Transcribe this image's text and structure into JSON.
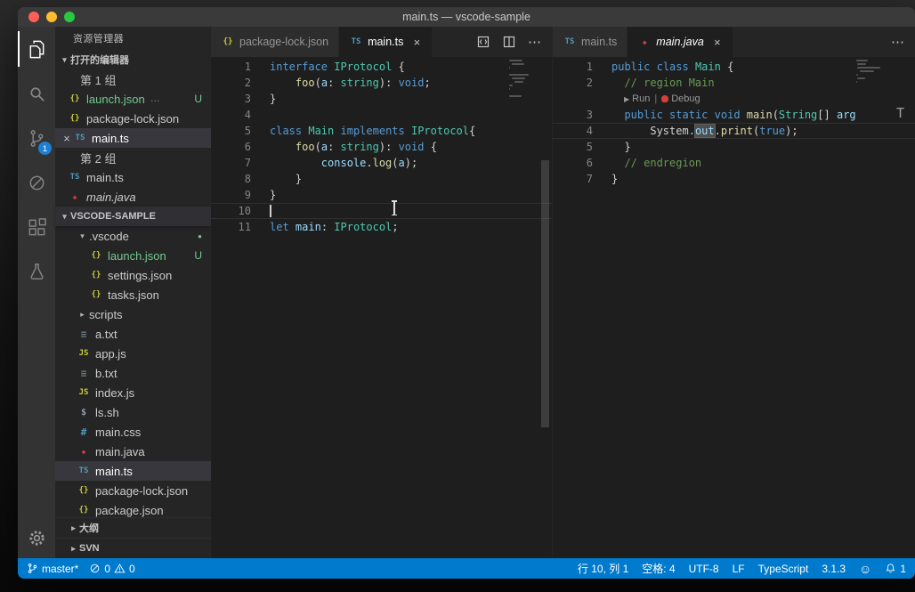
{
  "window": {
    "title": "main.ts — vscode-sample"
  },
  "icons": {
    "chevron-down": "▾",
    "chevron-right": "▸",
    "close": "×",
    "more-actions": "⋯",
    "run-play": "▶",
    "feedback-smiley": "☺",
    "modified-dot": "●"
  },
  "icon_glyphs": {
    "json": "{}",
    "ts": "TS",
    "js": "JS",
    "txt": "≡",
    "sh": "$",
    "css": "#",
    "java": "◆"
  },
  "colors": {
    "accent": "#007acc",
    "untracked_green": "#73c991",
    "selection": "#37373d",
    "scm_badge": "#1d80d6"
  },
  "activity_bar": {
    "scm_badge": "1",
    "items": [
      "explorer",
      "search",
      "source-control",
      "debug-disabled",
      "extensions",
      "test"
    ],
    "bottom": [
      "settings-gear"
    ]
  },
  "sidebar": {
    "title": "资源管理器",
    "sections": {
      "open_editors": "打开的编辑器",
      "root": "VSCODE-SAMPLE",
      "outline": "大纲",
      "svn": "SVN"
    },
    "open_editors_rows": [
      {
        "kind": "group",
        "label": "第 1 组"
      },
      {
        "kind": "file",
        "icon": "json",
        "name": "launch.json",
        "desc": "…",
        "badge": "U",
        "git": true
      },
      {
        "kind": "file",
        "icon": "json",
        "name": "package-lock.json"
      },
      {
        "kind": "file",
        "icon": "ts",
        "name": "main.ts",
        "active": true,
        "close": true
      },
      {
        "kind": "group",
        "label": "第 2 组"
      },
      {
        "kind": "file",
        "icon": "ts",
        "name": "main.ts"
      },
      {
        "kind": "file",
        "icon": "java",
        "name": "main.java",
        "italic": true
      }
    ],
    "tree_rows": [
      {
        "kind": "folder",
        "name": ".vscode",
        "expanded": true,
        "dot": true,
        "level": 1
      },
      {
        "kind": "file",
        "icon": "json",
        "name": "launch.json",
        "badge": "U",
        "git": true,
        "level": 2
      },
      {
        "kind": "file",
        "icon": "json",
        "name": "settings.json",
        "level": 2
      },
      {
        "kind": "file",
        "icon": "json",
        "name": "tasks.json",
        "level": 2
      },
      {
        "kind": "folder",
        "name": "scripts",
        "expanded": false,
        "level": 1
      },
      {
        "kind": "file",
        "icon": "txt",
        "name": "a.txt",
        "level": 1
      },
      {
        "kind": "file",
        "icon": "js",
        "name": "app.js",
        "level": 1
      },
      {
        "kind": "file",
        "icon": "txt",
        "name": "b.txt",
        "level": 1
      },
      {
        "kind": "file",
        "icon": "js",
        "name": "index.js",
        "level": 1
      },
      {
        "kind": "file",
        "icon": "sh",
        "name": "ls.sh",
        "level": 1
      },
      {
        "kind": "file",
        "icon": "css",
        "name": "main.css",
        "level": 1
      },
      {
        "kind": "file",
        "icon": "java",
        "name": "main.java",
        "level": 1
      },
      {
        "kind": "file",
        "icon": "ts",
        "name": "main.ts",
        "selected": true,
        "level": 1
      },
      {
        "kind": "file",
        "icon": "json",
        "name": "package-lock.json",
        "level": 1
      },
      {
        "kind": "file",
        "icon": "json",
        "name": "package.json",
        "level": 1
      }
    ]
  },
  "editors": {
    "left": {
      "tabs": [
        {
          "icon": "json",
          "label": "package-lock.json"
        },
        {
          "icon": "ts",
          "label": "main.ts",
          "active": true,
          "close": true
        }
      ],
      "toolbar": [
        "open-changes-icon",
        "split-editor-icon",
        "more-actions-icon"
      ],
      "lines": [
        {
          "num": 1,
          "tokens": [
            {
              "t": "interface",
              "c": "kw"
            },
            {
              "t": " ",
              "c": "pl"
            },
            {
              "t": "IProtocol",
              "c": "ty"
            },
            {
              "t": " {",
              "c": "pl"
            }
          ]
        },
        {
          "num": 2,
          "tokens": [
            {
              "t": "    ",
              "c": "pl"
            },
            {
              "t": "foo",
              "c": "fn"
            },
            {
              "t": "(",
              "c": "pl"
            },
            {
              "t": "a",
              "c": "va"
            },
            {
              "t": ": ",
              "c": "pl"
            },
            {
              "t": "string",
              "c": "ty"
            },
            {
              "t": "): ",
              "c": "pl"
            },
            {
              "t": "void",
              "c": "kw"
            },
            {
              "t": ";",
              "c": "pl"
            }
          ]
        },
        {
          "num": 3,
          "tokens": [
            {
              "t": "}",
              "c": "pl"
            }
          ]
        },
        {
          "num": 4,
          "tokens": []
        },
        {
          "num": 5,
          "tokens": [
            {
              "t": "class",
              "c": "kw"
            },
            {
              "t": " ",
              "c": "pl"
            },
            {
              "t": "Main",
              "c": "ty"
            },
            {
              "t": " ",
              "c": "pl"
            },
            {
              "t": "implements",
              "c": "kw"
            },
            {
              "t": " ",
              "c": "pl"
            },
            {
              "t": "IProtocol",
              "c": "ty"
            },
            {
              "t": "{",
              "c": "pl"
            }
          ]
        },
        {
          "num": 6,
          "tokens": [
            {
              "t": "    ",
              "c": "pl"
            },
            {
              "t": "foo",
              "c": "fn"
            },
            {
              "t": "(",
              "c": "pl"
            },
            {
              "t": "a",
              "c": "va"
            },
            {
              "t": ": ",
              "c": "pl"
            },
            {
              "t": "string",
              "c": "ty"
            },
            {
              "t": "): ",
              "c": "pl"
            },
            {
              "t": "void",
              "c": "kw"
            },
            {
              "t": " {",
              "c": "pl"
            }
          ]
        },
        {
          "num": 7,
          "tokens": [
            {
              "t": "        ",
              "c": "pl"
            },
            {
              "t": "console",
              "c": "va"
            },
            {
              "t": ".",
              "c": "pl"
            },
            {
              "t": "log",
              "c": "fn"
            },
            {
              "t": "(",
              "c": "pl"
            },
            {
              "t": "a",
              "c": "va"
            },
            {
              "t": ");",
              "c": "pl"
            }
          ]
        },
        {
          "num": 8,
          "tokens": [
            {
              "t": "    }",
              "c": "pl"
            }
          ]
        },
        {
          "num": 9,
          "tokens": [
            {
              "t": "}",
              "c": "pl"
            }
          ]
        },
        {
          "num": 10,
          "tokens": [],
          "current": true,
          "cursor": true
        },
        {
          "num": 11,
          "tokens": [
            {
              "t": "let",
              "c": "kw"
            },
            {
              "t": " ",
              "c": "pl"
            },
            {
              "t": "main",
              "c": "va"
            },
            {
              "t": ": ",
              "c": "pl"
            },
            {
              "t": "IProtocol",
              "c": "ty"
            },
            {
              "t": ";",
              "c": "pl"
            }
          ]
        }
      ]
    },
    "right": {
      "tabs": [
        {
          "icon": "ts",
          "label": "main.ts"
        },
        {
          "icon": "java",
          "label": "main.java",
          "active": true,
          "close": true,
          "italic": true
        }
      ],
      "toolbar": [
        "more-actions-icon"
      ],
      "codelens": {
        "run": "Run",
        "debug": "Debug"
      },
      "overflow_char": "T",
      "lines": [
        {
          "num": 1,
          "tokens": [
            {
              "t": "public",
              "c": "kw"
            },
            {
              "t": " ",
              "c": "pl"
            },
            {
              "t": "class",
              "c": "kw"
            },
            {
              "t": " ",
              "c": "pl"
            },
            {
              "t": "Main",
              "c": "ty"
            },
            {
              "t": " {",
              "c": "pl"
            }
          ]
        },
        {
          "num": 2,
          "tokens": [
            {
              "t": "  ",
              "c": "pl"
            },
            {
              "t": "// region Main",
              "c": "cm"
            }
          ]
        },
        {
          "lens": true
        },
        {
          "num": 3,
          "tokens": [
            {
              "t": "  ",
              "c": "pl"
            },
            {
              "t": "public",
              "c": "kw"
            },
            {
              "t": " ",
              "c": "pl"
            },
            {
              "t": "static",
              "c": "kw"
            },
            {
              "t": " ",
              "c": "pl"
            },
            {
              "t": "void",
              "c": "kw"
            },
            {
              "t": " ",
              "c": "pl"
            },
            {
              "t": "main",
              "c": "fn"
            },
            {
              "t": "(",
              "c": "pl"
            },
            {
              "t": "String",
              "c": "ty"
            },
            {
              "t": "[] ",
              "c": "pl"
            },
            {
              "t": "arg",
              "c": "va"
            }
          ]
        },
        {
          "num": 4,
          "current": true,
          "tokens": [
            {
              "t": "      ",
              "c": "pl"
            },
            {
              "t": "System",
              "c": "pl"
            },
            {
              "t": ".",
              "c": "pl"
            },
            {
              "t": "out",
              "c": "va",
              "hl": true
            },
            {
              "t": ".",
              "c": "pl"
            },
            {
              "t": "print",
              "c": "fn"
            },
            {
              "t": "(",
              "c": "pl"
            },
            {
              "t": "true",
              "c": "kw"
            },
            {
              "t": ");",
              "c": "pl"
            }
          ]
        },
        {
          "num": 5,
          "tokens": [
            {
              "t": "  }",
              "c": "pl"
            }
          ]
        },
        {
          "num": 6,
          "tokens": [
            {
              "t": "  ",
              "c": "pl"
            },
            {
              "t": "// endregion",
              "c": "cm"
            }
          ]
        },
        {
          "num": 7,
          "tokens": [
            {
              "t": "}",
              "c": "pl"
            }
          ]
        }
      ]
    }
  },
  "status_bar": {
    "branch": "master*",
    "errors": "0",
    "warnings": "0",
    "line_col": "行 10, 列 1",
    "indent": "空格: 4",
    "encoding": "UTF-8",
    "eol": "LF",
    "language": "TypeScript",
    "version": "3.1.3",
    "notifications": "1"
  }
}
